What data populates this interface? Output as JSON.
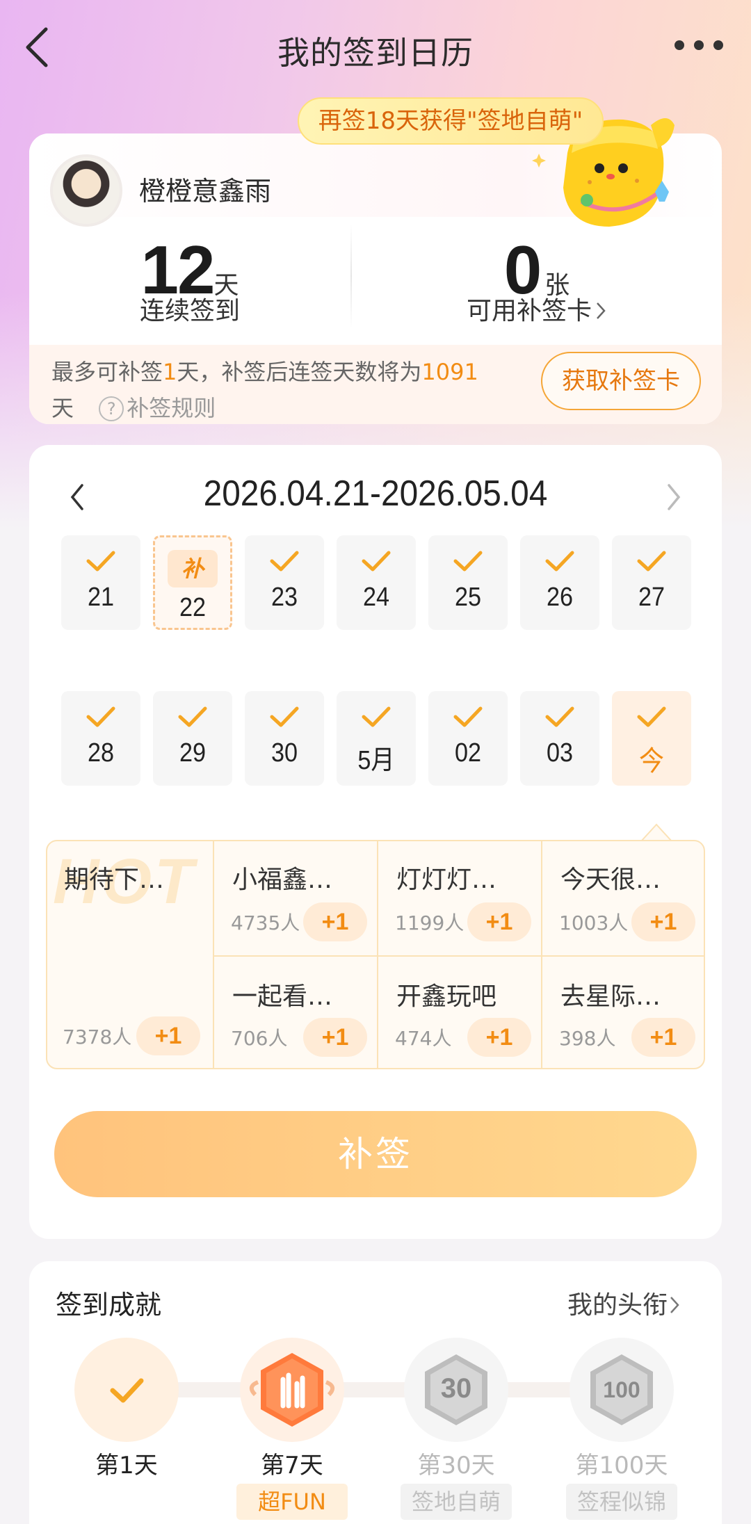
{
  "header": {
    "title": "我的签到日历"
  },
  "banner": {
    "text": "再签18天获得\"签地自萌\""
  },
  "profile": {
    "username": "橙橙意鑫雨"
  },
  "stats": {
    "streak_value": "12",
    "streak_unit": "天",
    "streak_label": "连续签到",
    "cards_value": "0",
    "cards_unit": "张",
    "cards_label": "可用补签卡"
  },
  "makeup_tip": {
    "line1_prefix": "最多可补签",
    "line1_days": "1",
    "line1_mid": "天，补签后连签天数将为",
    "line1_total": "1091",
    "line2_suffix": "天",
    "rules_label": "补签规则",
    "get_card_button": "获取补签卡"
  },
  "calendar": {
    "range": "2026.04.21-2026.05.04",
    "days": [
      {
        "label": "21",
        "state": "checked"
      },
      {
        "label": "22",
        "state": "makeup",
        "badge": "补"
      },
      {
        "label": "23",
        "state": "checked"
      },
      {
        "label": "24",
        "state": "checked"
      },
      {
        "label": "25",
        "state": "checked"
      },
      {
        "label": "26",
        "state": "checked"
      },
      {
        "label": "27",
        "state": "checked"
      },
      {
        "label": "28",
        "state": "checked"
      },
      {
        "label": "29",
        "state": "checked"
      },
      {
        "label": "30",
        "state": "checked"
      },
      {
        "label": "5月",
        "state": "checked"
      },
      {
        "label": "02",
        "state": "checked"
      },
      {
        "label": "03",
        "state": "checked"
      },
      {
        "label": "今",
        "state": "today"
      }
    ]
  },
  "topics": {
    "hot_watermark": "HOT",
    "featured": {
      "name": "期待下…",
      "count": "7378人",
      "plus": "+1"
    },
    "items": [
      {
        "name": "小福鑫…",
        "count": "4735人",
        "plus": "+1"
      },
      {
        "name": "灯灯灯…",
        "count": "1199人",
        "plus": "+1"
      },
      {
        "name": "今天很…",
        "count": "1003人",
        "plus": "+1"
      },
      {
        "name": "一起看…",
        "count": "706人",
        "plus": "+1"
      },
      {
        "name": "开鑫玩吧",
        "count": "474人",
        "plus": "+1"
      },
      {
        "name": "去星际…",
        "count": "398人",
        "plus": "+1"
      }
    ]
  },
  "makeup_button": "补签",
  "achievements": {
    "title": "签到成就",
    "my_titles_link": "我的头衔",
    "milestones": [
      {
        "day": "第1天",
        "tag": "",
        "active": true
      },
      {
        "day": "第7天",
        "tag": "超FUN",
        "active": true
      },
      {
        "day": "第30天",
        "tag": "签地自萌",
        "active": false,
        "badge_text": "30"
      },
      {
        "day": "第100天",
        "tag": "签程似锦",
        "active": false,
        "badge_text": "100"
      }
    ]
  },
  "colors": {
    "accent": "#f28c13",
    "button": "#ffc37c",
    "banner_text": "#d9640b"
  }
}
